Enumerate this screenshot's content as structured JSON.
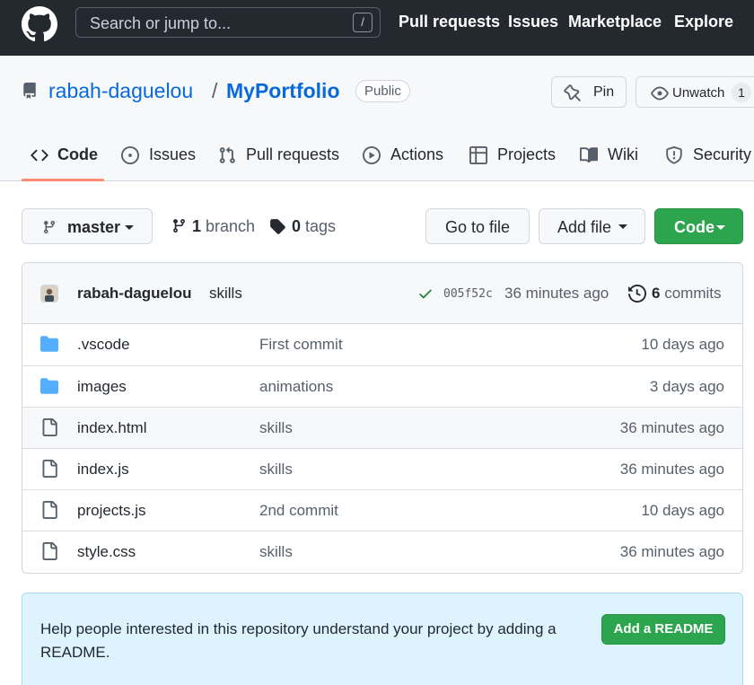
{
  "header": {
    "search_placeholder": "Search or jump to...",
    "search_shortcut": "/",
    "nav": [
      "Pull requests",
      "Issues",
      "Marketplace",
      "Explore"
    ]
  },
  "repo": {
    "owner": "rabah-daguelou",
    "separator": "/",
    "name": "MyPortfolio",
    "visibility": "Public",
    "pin_label": "Pin",
    "watch_label": "Unwatch",
    "watch_count": "1"
  },
  "tabs": [
    {
      "label": "Code",
      "icon": "code-icon",
      "selected": true
    },
    {
      "label": "Issues",
      "icon": "issue-opened-icon"
    },
    {
      "label": "Pull requests",
      "icon": "git-pull-request-icon"
    },
    {
      "label": "Actions",
      "icon": "play-icon"
    },
    {
      "label": "Projects",
      "icon": "table-icon"
    },
    {
      "label": "Wiki",
      "icon": "book-icon"
    },
    {
      "label": "Security",
      "icon": "shield-icon"
    }
  ],
  "branch_bar": {
    "branch": "master",
    "branch_count": "1",
    "branch_word": "branch",
    "tag_count": "0",
    "tag_word": "tags",
    "go_to_file": "Go to file",
    "add_file": "Add file",
    "code": "Code"
  },
  "commit": {
    "author": "rabah-daguelou",
    "message": "skills",
    "sha": "005f52c",
    "time": "36 minutes ago",
    "commit_count": "6",
    "commit_word": "commits"
  },
  "files": [
    {
      "name": ".vscode",
      "type": "dir",
      "message": "First commit",
      "time": "10 days ago"
    },
    {
      "name": "images",
      "type": "dir",
      "message": "animations",
      "time": "3 days ago"
    },
    {
      "name": "index.html",
      "type": "file",
      "message": "skills",
      "time": "36 minutes ago"
    },
    {
      "name": "index.js",
      "type": "file",
      "message": "skills",
      "time": "36 minutes ago"
    },
    {
      "name": "projects.js",
      "type": "file",
      "message": "2nd commit",
      "time": "10 days ago"
    },
    {
      "name": "style.css",
      "type": "file",
      "message": "skills",
      "time": "36 minutes ago"
    }
  ],
  "readme": {
    "text": "Help people interested in this repository understand your project by adding a README.",
    "button": "Add a README"
  },
  "colors": {
    "header_bg": "#24292f",
    "link": "#0969da",
    "green_button": "#2da44e",
    "selected_tab_underline": "#fd8c73",
    "folder": "#54aeff",
    "readme_bg": "#ddf4ff"
  }
}
